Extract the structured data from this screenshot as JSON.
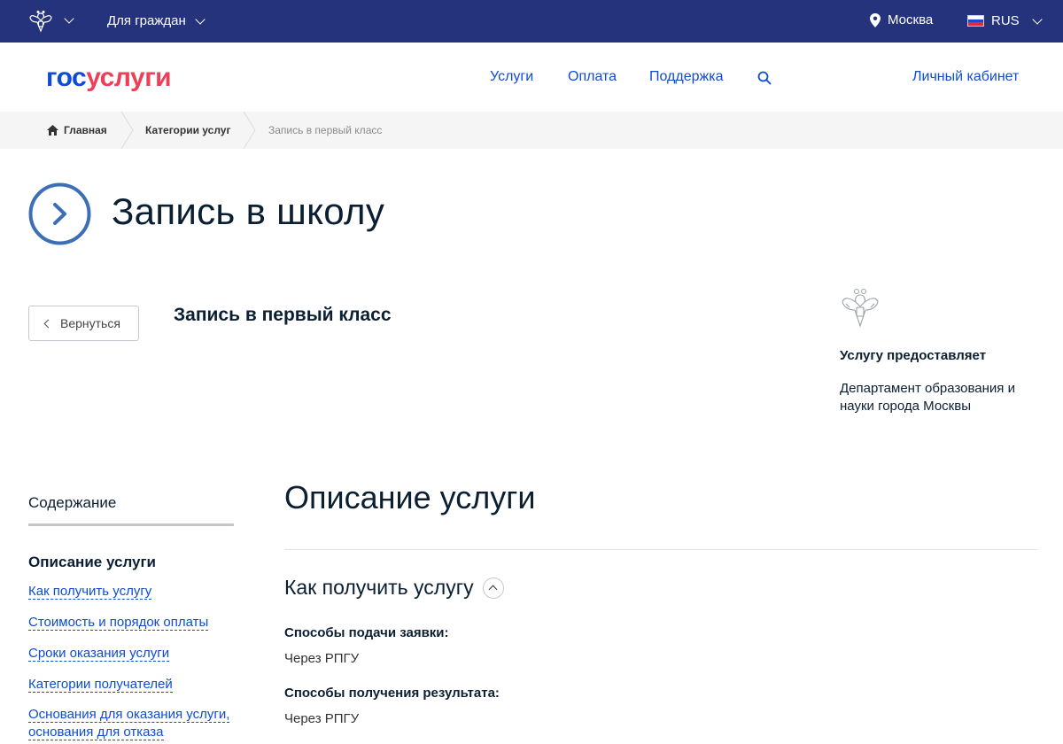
{
  "topbar": {
    "audience": "Для граждан",
    "city": "Москва",
    "language": "RUS"
  },
  "header": {
    "logo_part1": "гос",
    "logo_part2": "услуги",
    "nav_services": "Услуги",
    "nav_payment": "Оплата",
    "nav_support": "Поддержка",
    "cabinet": "Личный кабинет"
  },
  "breadcrumb": {
    "home": "Главная",
    "categories": "Категории услуг",
    "current": "Запись в первый класс"
  },
  "page": {
    "title": "Запись в школу",
    "back_label": "Вернуться",
    "subtitle": "Запись в первый класс"
  },
  "provider": {
    "heading": "Услугу предоставляет",
    "name": "Департамент образования и науки города Москвы"
  },
  "toc": {
    "title": "Содержание",
    "active": "Описание услуги",
    "links": [
      "Как получить услугу",
      "Стоимость и порядок оплаты",
      "Сроки оказания услуги",
      "Категории получателей",
      "Основания для оказания услуги, основания для отказа"
    ]
  },
  "content": {
    "section_title": "Описание услуги",
    "how_to_title": "Как получить услугу",
    "fields": [
      {
        "label": "Способы подачи заявки:",
        "value": "Через РПГУ"
      },
      {
        "label": "Способы получения результата:",
        "value": "Через РПГУ"
      }
    ]
  },
  "colors": {
    "topbar_bg": "#25337c",
    "brand_blue": "#0d4cd3",
    "brand_red": "#ee3f58",
    "breadcrumb_bg": "#f5f5f5"
  }
}
